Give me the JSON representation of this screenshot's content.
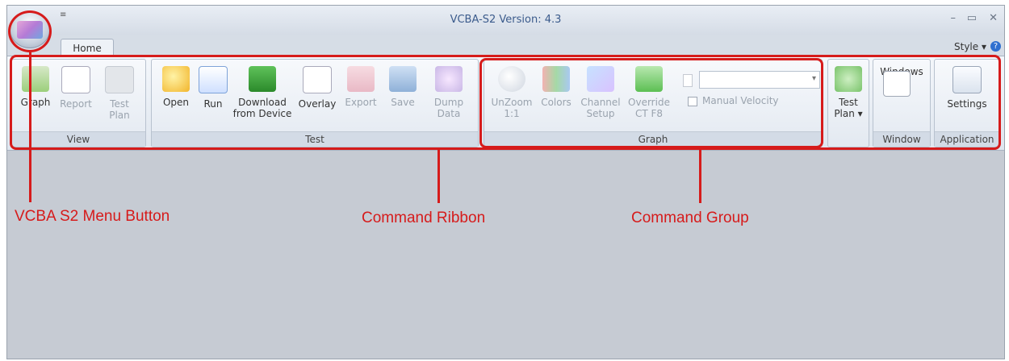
{
  "window": {
    "title": "VCBA-S2 Version: 4.3",
    "qat": "≡",
    "min": "–",
    "max": "▭",
    "close": "✕"
  },
  "tabs": [
    {
      "label": "Home"
    }
  ],
  "style": {
    "label": "Style",
    "arrow": "▾",
    "help": "?"
  },
  "groups": {
    "view": {
      "label": "View",
      "buttons": [
        "Graph",
        "Report",
        "Test\nPlan"
      ]
    },
    "test": {
      "label": "Test",
      "buttons": [
        "Open",
        "Run",
        "Download\nfrom Device",
        "Overlay",
        "Export",
        "Save",
        "Dump\nData"
      ]
    },
    "graph": {
      "label": "Graph",
      "buttons": [
        "UnZoom\n1:1",
        "Colors",
        "Channel\nSetup",
        "Override\nCT F8"
      ],
      "checkbox_label": "Manual Velocity"
    },
    "testplan": {
      "label": "Test\nPlan ▾"
    },
    "window": {
      "label": "Window",
      "buttons": [
        "Windows\n▾"
      ]
    },
    "application": {
      "label": "Application",
      "buttons": [
        "Settings"
      ]
    }
  },
  "annotations": {
    "menu_button": "VCBA S2 Menu Button",
    "ribbon": "Command Ribbon",
    "group": "Command Group"
  },
  "colors": {
    "annotation": "#d61b1b"
  }
}
